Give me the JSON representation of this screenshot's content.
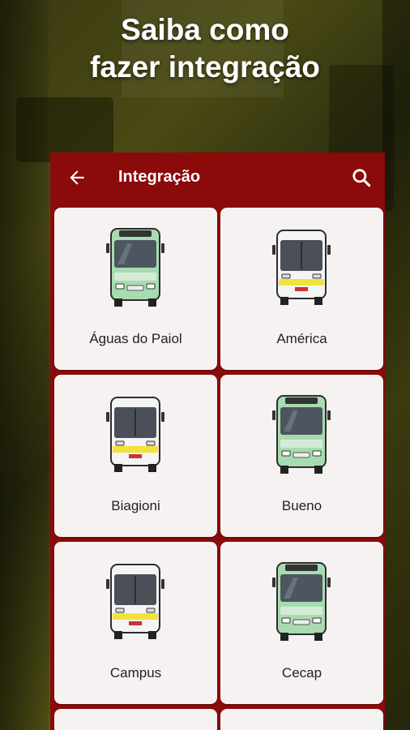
{
  "headline": {
    "line1": "Saiba como",
    "line2": "fazer integração"
  },
  "app_bar": {
    "title": "Integração",
    "back_icon": "arrow-left-icon",
    "search_icon": "search-icon"
  },
  "colors": {
    "app_bar": "#8b0a0a",
    "card_bg": "#f6f2f2"
  },
  "lines": [
    {
      "label": "Águas do Paiol",
      "bus_style": "green"
    },
    {
      "label": "América",
      "bus_style": "white-yellow"
    },
    {
      "label": "Biagioni",
      "bus_style": "white-yellow"
    },
    {
      "label": "Bueno",
      "bus_style": "green"
    },
    {
      "label": "Campus",
      "bus_style": "white-yellow"
    },
    {
      "label": "Cecap",
      "bus_style": "green"
    }
  ]
}
